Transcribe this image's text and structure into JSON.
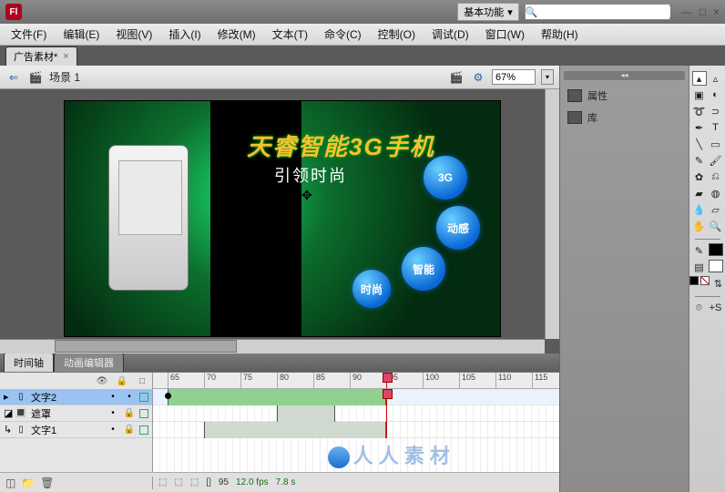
{
  "title_logo": "Fl",
  "workspace_label": "基本功能",
  "search_placeholder": "",
  "menus": [
    "文件(F)",
    "编辑(E)",
    "视图(V)",
    "插入(I)",
    "修改(M)",
    "文本(T)",
    "命令(C)",
    "控制(O)",
    "调试(D)",
    "窗口(W)",
    "帮助(H)"
  ],
  "doc_tab": {
    "label": "广告素材*",
    "close": "×"
  },
  "edit_toolbar": {
    "back_icon": "⇐",
    "scene_icon": "🎬",
    "scene_label": "场景 1",
    "edit_scene_icon": "🎬",
    "symbol_icon": "⚙",
    "zoom": "67%"
  },
  "canvas": {
    "title": "天睿智能3G手机",
    "subtitle": "引领时尚",
    "bubbles": [
      "3G",
      "动感",
      "智能",
      "时尚"
    ]
  },
  "bottom_tabs": [
    "时间轴",
    "动画编辑器"
  ],
  "timeline": {
    "ruler_ticks": [
      65,
      70,
      75,
      80,
      85,
      90,
      95,
      100,
      105,
      110,
      115
    ],
    "playhead_frame": 95,
    "layers": [
      {
        "name": "文字2",
        "selected": true,
        "locked": false,
        "type": "normal"
      },
      {
        "name": "遮罩",
        "selected": false,
        "locked": true,
        "type": "mask"
      },
      {
        "name": "文字1",
        "selected": false,
        "locked": true,
        "type": "masked"
      }
    ],
    "footer": {
      "frame": "95",
      "fps": "12.0 fps",
      "time": "7.8 s"
    }
  },
  "panels": [
    {
      "icon": "props",
      "label": "属性"
    },
    {
      "icon": "lib",
      "label": "库"
    }
  ],
  "watermark": "人 人 素 材",
  "tool_names": {
    "arrow": "selection-tool",
    "subsel": "subselection-tool",
    "lasso": "lasso-tool",
    "freetx": "free-transform-tool",
    "3drot": "3d-rotation-tool",
    "lasso2": "lasso-tool",
    "pen": "pen-tool",
    "text": "text-tool",
    "line": "line-tool",
    "rect": "rectangle-tool",
    "pencil": "pencil-tool",
    "brush": "brush-tool",
    "deco": "deco-tool",
    "bone": "bone-tool",
    "bucket": "paint-bucket-tool",
    "ink": "ink-bottle-tool",
    "dropper": "eyedropper-tool",
    "eraser": "eraser-tool",
    "hand": "hand-tool",
    "zoom": "zoom-tool"
  }
}
